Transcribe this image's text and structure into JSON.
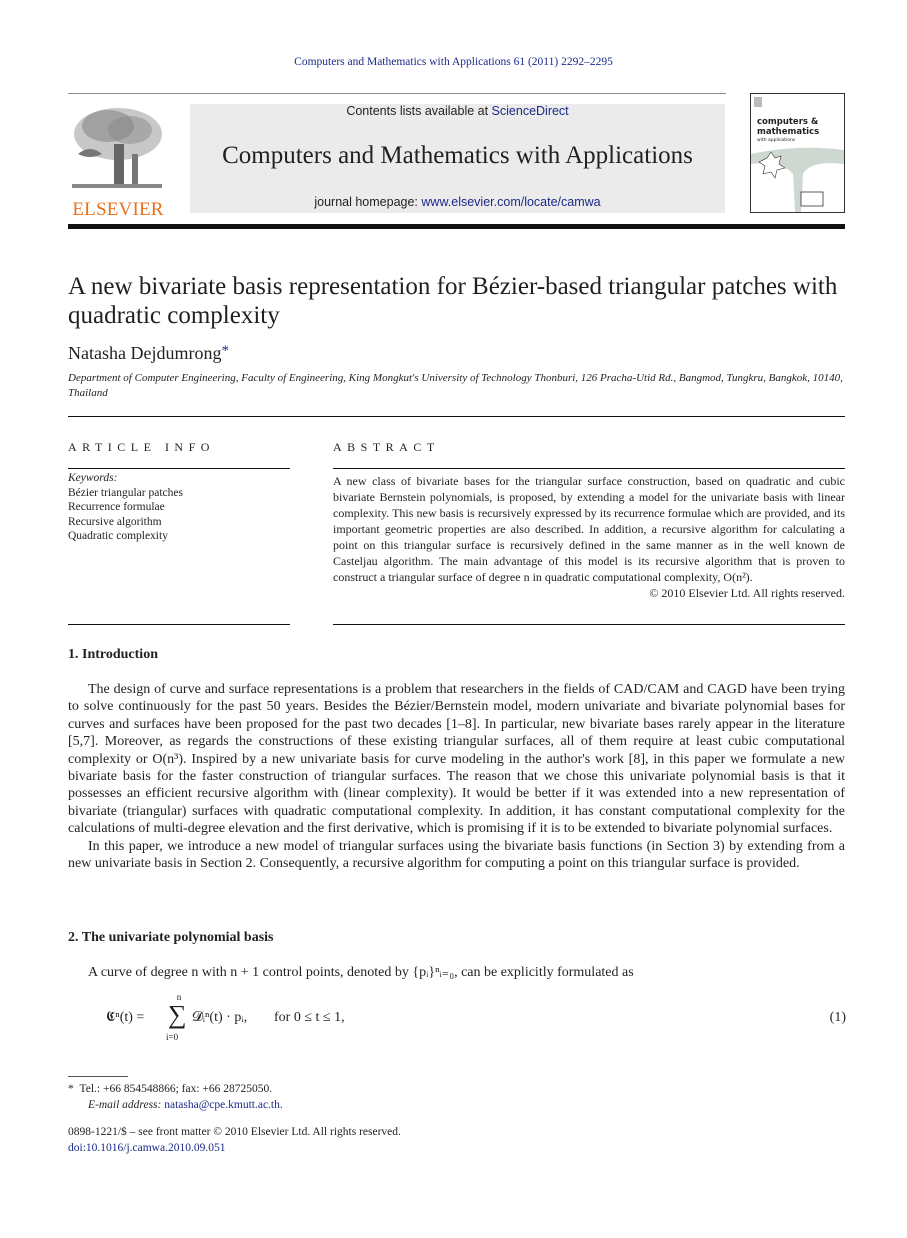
{
  "running_head": "Computers and Mathematics with Applications 61 (2011) 2292–2295",
  "masthead": {
    "publisher_logo": "ELSEVIER",
    "contents_prefix": "Contents lists available at ",
    "contents_link": "ScienceDirect",
    "journal_title": "Computers and Mathematics with Applications",
    "homepage_prefix": "journal homepage: ",
    "homepage_link": "www.elsevier.com/locate/camwa",
    "cover_line1": "computers &",
    "cover_line2": "mathematics",
    "cover_line3": "with applications"
  },
  "article": {
    "title": "A new bivariate basis representation for Bézier-based triangular patches with quadratic complexity",
    "author": "Natasha Dejdumrong",
    "author_mark": "*",
    "affiliation": "Department of Computer Engineering, Faculty of Engineering, King Mongkut's University of Technology Thonburi, 126 Pracha-Utid Rd., Bangmod, Tungkru, Bangkok, 10140, Thailand"
  },
  "article_info": {
    "heading": "ARTICLE INFO",
    "keywords_label": "Keywords:",
    "keywords": [
      "Bézier triangular patches",
      "Recurrence formulae",
      "Recursive algorithm",
      "Quadratic complexity"
    ]
  },
  "abstract": {
    "heading": "ABSTRACT",
    "text": "A new class of bivariate bases for the triangular surface construction, based on quadratic and cubic bivariate Bernstein polynomials, is proposed, by extending a model for the univariate basis with linear complexity. This new basis is recursively expressed by its recurrence formulae which are provided, and its important geometric properties are also described. In addition, a recursive algorithm for calculating a point on this triangular surface is recursively defined in the same manner as in the well known de Casteljau algorithm. The main advantage of this model is its recursive algorithm that is proven to construct a triangular surface of degree n in quadratic computational complexity, O(n²).",
    "copyright": "© 2010 Elsevier Ltd. All rights reserved."
  },
  "sections": [
    {
      "heading": "1.  Introduction",
      "paragraphs": [
        "The design of curve and surface representations is a problem that researchers in the fields of CAD/CAM and CAGD have been trying to solve continuously for the past 50 years. Besides the Bézier/Bernstein model, modern univariate and bivariate polynomial bases for curves and surfaces have been proposed for the past two decades [1–8]. In particular, new bivariate bases rarely appear in the literature [5,7]. Moreover, as regards the constructions of these existing triangular surfaces, all of them require at least cubic computational complexity or O(n³). Inspired by a new univariate basis for curve modeling in the author's work [8], in this paper we formulate a new bivariate basis for the faster construction of triangular surfaces. The reason that we chose this univariate polynomial basis is that it possesses an efficient recursive algorithm with (linear complexity). It would be better if it was extended into a new representation of bivariate (triangular) surfaces with quadratic computational complexity. In addition, it has constant computational complexity for the calculations of multi-degree elevation and the first derivative, which is promising if it is to be extended to bivariate polynomial surfaces.",
        "In this paper, we introduce a new model of triangular surfaces using the bivariate basis functions (in Section 3) by extending from a new univariate basis in Section 2. Consequently, a recursive algorithm for computing a point on this triangular surface is provided."
      ]
    },
    {
      "heading": "2.  The univariate polynomial basis",
      "paragraphs": [
        "A curve of degree n with n + 1 control points, denoted by {pᵢ}ⁿᵢ₌₀, can be explicitly formulated as"
      ]
    }
  ],
  "equation": {
    "lhs": "𝕮ⁿ(t) =",
    "sum_top": "n",
    "sum_symbol": "∑",
    "sum_bottom": "i=0",
    "rhs": "𝓓ᵢⁿ(t) · pᵢ,",
    "condition": "for 0 ≤ t ≤ 1,",
    "number": "(1)"
  },
  "footnote": {
    "mark": "*",
    "contact": "Tel.: +66 854548866; fax: +66 28725050.",
    "email_label": "E-mail address: ",
    "email": "natasha@cpe.kmutt.ac.th",
    "email_suffix": "."
  },
  "front_matter": {
    "issn_line": "0898-1221/$ – see front matter © 2010 Elsevier Ltd. All rights reserved.",
    "doi": "doi:10.1016/j.camwa.2010.09.051"
  },
  "colors": {
    "link": "#1c2a8a",
    "elsevier_orange": "#e9711c",
    "banner_gray": "#ebebeb"
  }
}
